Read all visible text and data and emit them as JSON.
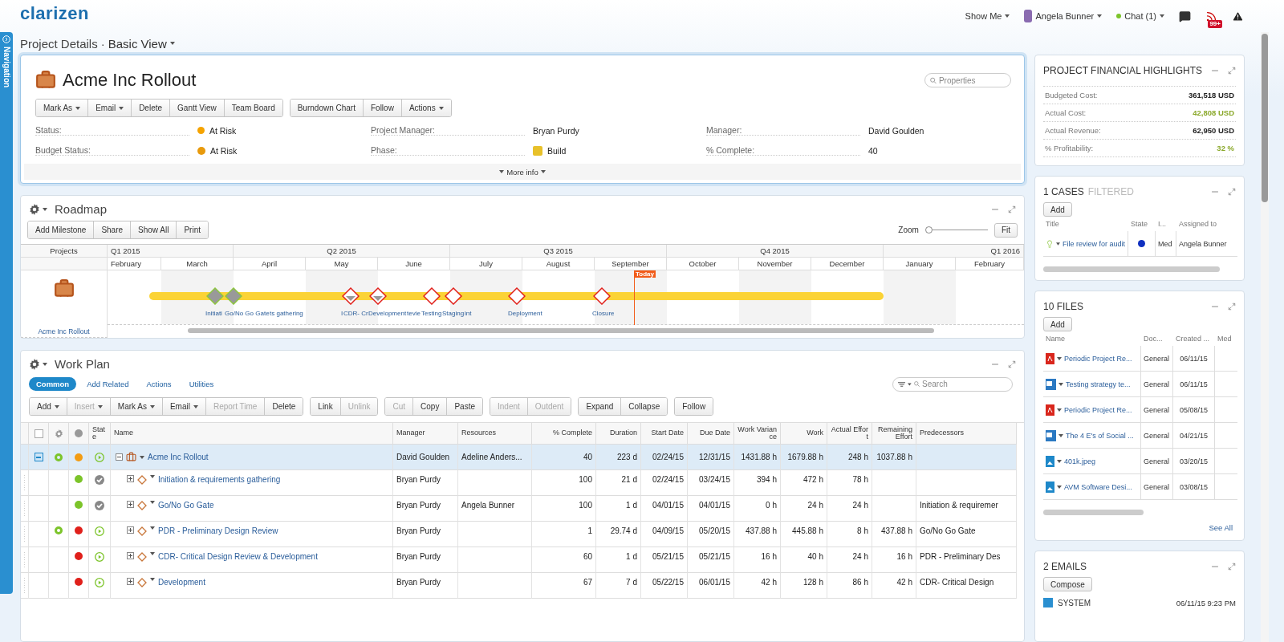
{
  "header": {
    "logo": "clarizen",
    "show_me": "Show Me",
    "user": "Angela Bunner",
    "chat": "Chat (1)",
    "notification_badge": "99+"
  },
  "navigation_tab": "Navigation",
  "breadcrumb": {
    "page": "Project Details",
    "separator": "·",
    "view": "Basic View"
  },
  "project": {
    "title": "Acme Inc Rollout",
    "search_placeholder": "Properties",
    "button_groups": [
      [
        {
          "label": "Mark As",
          "dropdown": true
        },
        {
          "label": "Email",
          "dropdown": true
        },
        {
          "label": "Delete",
          "dropdown": false
        },
        {
          "label": "Gantt View",
          "dropdown": false
        },
        {
          "label": "Team Board",
          "dropdown": false
        }
      ],
      [
        {
          "label": "Burndown Chart",
          "dropdown": false
        },
        {
          "label": "Follow",
          "dropdown": false
        },
        {
          "label": "Actions",
          "dropdown": true
        }
      ]
    ],
    "field_columns": [
      [
        {
          "label": "Status:",
          "value": "At Risk",
          "kind": "status"
        },
        {
          "label": "Budget Status:",
          "value": "At Risk",
          "kind": "budget"
        }
      ],
      [
        {
          "label": "Project Manager:",
          "value": "Bryan Purdy",
          "kind": "plain"
        },
        {
          "label": "Phase:",
          "value": "Build",
          "kind": "phase"
        }
      ],
      [
        {
          "label": "Manager:",
          "value": "David Goulden",
          "kind": "plain"
        },
        {
          "label": "% Complete:",
          "value": "40",
          "kind": "plain"
        }
      ]
    ],
    "more_info": "More info"
  },
  "roadmap": {
    "title": "Roadmap",
    "buttons": [
      "Add Milestone",
      "Share",
      "Show All",
      "Print"
    ],
    "zoom": {
      "label": "Zoom",
      "level": 0
    },
    "fit": "Fit",
    "projects_header": "Projects",
    "quarters": [
      "Q1 2015",
      "Q2 2015",
      "Q3 2015",
      "Q4 2015",
      "Q1 2016"
    ],
    "months": [
      "February",
      "March",
      "April",
      "May",
      "June",
      "July",
      "August",
      "September",
      "October",
      "November",
      "December",
      "January",
      "February"
    ],
    "project_name": "Acme Inc Rollout",
    "today": "Today",
    "milestones": [
      {
        "kind": "complete"
      },
      {
        "kind": "complete"
      },
      {
        "kind": "started"
      },
      {
        "kind": "started"
      },
      {
        "kind": "open"
      },
      {
        "kind": "open"
      },
      {
        "kind": "open"
      },
      {
        "kind": "open"
      }
    ],
    "milestone_labels": [
      "Initiati",
      "Go/No Go Gate",
      "ts gathering",
      "I",
      "CDR- Cr",
      "Development",
      "tevie",
      "Testing",
      "Staging",
      "int",
      "Deployment",
      "Closure"
    ]
  },
  "work_plan": {
    "title": "Work Plan",
    "tabs": [
      {
        "label": "Common",
        "selected": true
      },
      {
        "label": "Add Related",
        "selected": false
      },
      {
        "label": "Actions",
        "selected": false
      },
      {
        "label": "Utilities",
        "selected": false
      }
    ],
    "search_placeholder": "Search",
    "toolbar": [
      [
        {
          "label": "Add",
          "dropdown": true,
          "disabled": false
        },
        {
          "label": "Insert",
          "dropdown": true,
          "disabled": true
        },
        {
          "label": "Mark As",
          "dropdown": true,
          "disabled": false
        },
        {
          "label": "Email",
          "dropdown": true,
          "disabled": false
        },
        {
          "label": "Report Time",
          "dropdown": false,
          "disabled": true
        },
        {
          "label": "Delete",
          "dropdown": false,
          "disabled": false
        }
      ],
      [
        {
          "label": "Link",
          "dropdown": false,
          "disabled": false
        },
        {
          "label": "Unlink",
          "dropdown": false,
          "disabled": true
        }
      ],
      [
        {
          "label": "Cut",
          "dropdown": false,
          "disabled": true
        },
        {
          "label": "Copy",
          "dropdown": false,
          "disabled": false
        },
        {
          "label": "Paste",
          "dropdown": false,
          "disabled": false
        }
      ],
      [
        {
          "label": "Indent",
          "dropdown": false,
          "disabled": true
        },
        {
          "label": "Outdent",
          "dropdown": false,
          "disabled": true
        }
      ],
      [
        {
          "label": "Expand",
          "dropdown": false,
          "disabled": false
        },
        {
          "label": "Collapse",
          "dropdown": false,
          "disabled": false
        }
      ],
      [
        {
          "label": "Follow",
          "dropdown": false,
          "disabled": false
        }
      ]
    ],
    "select_all_checked": false,
    "columns": [
      "State",
      "Name",
      "Manager",
      "Resources",
      "% Complete",
      "Duration",
      "Start Date",
      "Due Date",
      "Work Variance",
      "Work",
      "Actual Effort",
      "Remaining Effort",
      "Predecessors"
    ],
    "rows": [
      {
        "name": "Acme Inc Rollout",
        "kind": "project",
        "selected": true,
        "expanded": true,
        "indicator": true,
        "color": "#f39c12",
        "completed": false,
        "manager": "David Goulden",
        "resources": "Adeline Anders...",
        "complete": "40",
        "duration": "223 d",
        "start": "02/24/15",
        "due": "12/31/15",
        "work_variance": "1431.88 h",
        "work": "1679.88 h",
        "actual_effort": "248 h",
        "remaining_effort": "1037.88 h",
        "children": [
          {
            "name": "Initiation & requirements gathering",
            "kind": "milestone",
            "selected": false,
            "expanded": false,
            "indicator": false,
            "color": "#7cc42a",
            "completed": true,
            "manager": "Bryan Purdy",
            "complete": "100",
            "duration": "21 d",
            "start": "02/24/15",
            "due": "03/24/15",
            "work_variance": "394 h",
            "work": "472 h",
            "actual_effort": "78 h"
          },
          {
            "name": "Go/No Go Gate",
            "kind": "milestone",
            "selected": false,
            "expanded": false,
            "indicator": false,
            "color": "#7cc42a",
            "completed": true,
            "manager": "Bryan Purdy",
            "resources": "Angela Bunner",
            "complete": "100",
            "duration": "1 d",
            "start": "04/01/15",
            "due": "04/01/15",
            "work_variance": "0 h",
            "work": "24 h",
            "actual_effort": "24 h",
            "predecessors": "Initiation & requiremer"
          },
          {
            "name": "PDR - Preliminary Design Review",
            "kind": "milestone",
            "selected": false,
            "expanded": false,
            "indicator": true,
            "color": "#e0201b",
            "completed": false,
            "manager": "Bryan Purdy",
            "complete": "1",
            "duration": "29.74 d",
            "start": "04/09/15",
            "due": "05/20/15",
            "work_variance": "437.88 h",
            "work": "445.88 h",
            "actual_effort": "8 h",
            "remaining_effort": "437.88 h",
            "predecessors": "Go/No Go Gate"
          },
          {
            "name": "CDR- Critical Design Review & Development",
            "kind": "milestone",
            "selected": false,
            "expanded": false,
            "indicator": false,
            "color": "#e0201b",
            "completed": false,
            "manager": "Bryan Purdy",
            "complete": "60",
            "duration": "1 d",
            "start": "05/21/15",
            "due": "05/21/15",
            "work_variance": "16 h",
            "work": "40 h",
            "actual_effort": "24 h",
            "remaining_effort": "16 h",
            "predecessors": "PDR - Preliminary Des"
          },
          {
            "name": "Development",
            "kind": "milestone",
            "selected": false,
            "expanded": false,
            "indicator": false,
            "color": "#e0201b",
            "completed": false,
            "manager": "Bryan Purdy",
            "complete": "67",
            "duration": "7 d",
            "start": "05/22/15",
            "due": "06/01/15",
            "work_variance": "42 h",
            "work": "128 h",
            "actual_effort": "86 h",
            "remaining_effort": "42 h",
            "predecessors": "CDR- Critical Design"
          }
        ]
      }
    ]
  },
  "financial": {
    "title": "PROJECT FINANCIAL HIGHLIGHTS",
    "rows": [
      {
        "label": "Budgeted Cost:",
        "value": "361,518 USD",
        "positive": false
      },
      {
        "label": "Actual Cost:",
        "value": "42,808 USD",
        "positive": true
      },
      {
        "label": "Actual Revenue:",
        "value": "62,950 USD",
        "positive": false
      },
      {
        "label": "% Profitability:",
        "value": "32 %",
        "positive": true
      }
    ]
  },
  "cases": {
    "title": "1 CASES",
    "filter": "FILTERED",
    "add": "Add",
    "columns": [
      "Title",
      "State",
      "I...",
      "Assigned to"
    ],
    "rows": [
      {
        "title": "File review for audit",
        "impact": "Med",
        "assigned": "Angela Bunner"
      }
    ]
  },
  "files": {
    "title": "10 FILES",
    "add": "Add",
    "columns": [
      "Name",
      "Doc...",
      "Created ...",
      "Med"
    ],
    "rows": [
      {
        "kind": "pdf",
        "name": "Periodic Project Re...",
        "doc": "General",
        "created": "06/11/15"
      },
      {
        "kind": "word",
        "name": "Testing strategy te...",
        "doc": "General",
        "created": "06/11/15"
      },
      {
        "kind": "pdf",
        "name": "Periodic Project Re...",
        "doc": "General",
        "created": "05/08/15"
      },
      {
        "kind": "word",
        "name": "The 4 E's of Social ...",
        "doc": "General",
        "created": "04/21/15"
      },
      {
        "kind": "image",
        "name": "401k.jpeg",
        "doc": "General",
        "created": "03/20/15"
      },
      {
        "kind": "image",
        "name": "AVM Software Desi...",
        "doc": "General",
        "created": "03/08/15"
      }
    ],
    "see_all": "See All"
  },
  "emails": {
    "title": "2 EMAILS",
    "compose": "Compose",
    "rows": [
      {
        "sender": "SYSTEM",
        "date": "06/11/15 9:23 PM"
      }
    ]
  }
}
